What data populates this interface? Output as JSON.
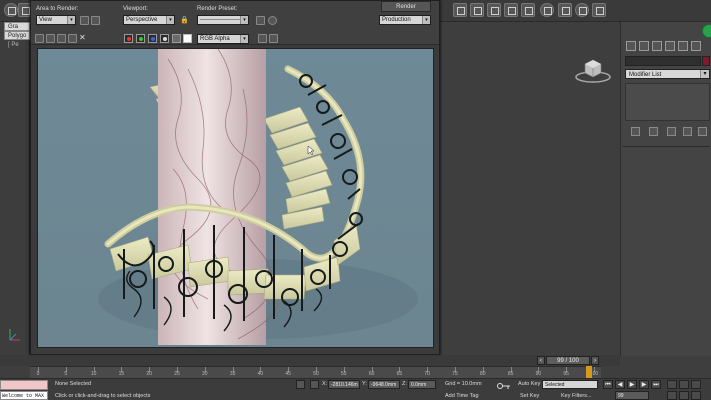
{
  "render_dialog": {
    "area_label": "Area to Render:",
    "area_value": "View",
    "viewport_label": "Viewport:",
    "viewport_value": "Perspective",
    "preset_label": "Render Preset:",
    "preset_value": "--------------------",
    "render_button": "Render",
    "production_value": "Production",
    "channel_value": "RGB Alpha"
  },
  "left_tabs": [
    "Gra",
    "Polygo"
  ],
  "viewport_label": "[ Pe",
  "command_panel": {
    "modifier_list": "Modifier List"
  },
  "timeline": {
    "frame": "99 / 100",
    "ticks": [
      "0",
      "5",
      "10",
      "15",
      "20",
      "25",
      "30",
      "35",
      "40",
      "45",
      "50",
      "55",
      "60",
      "65",
      "70",
      "75",
      "80",
      "85",
      "90",
      "95",
      "100"
    ]
  },
  "status_bar": {
    "selection": "None Selected",
    "prompt": "Click or click-and-drag to select objects",
    "x_label": "X:",
    "x_value": "-2810.146m",
    "y_label": "Y:",
    "y_value": "-9648.0mm",
    "z_label": "Z:",
    "z_value": "0.0mm",
    "grid": "Grid = 10.0mm",
    "add_time_tag": "Add Time Tag",
    "auto_key": "Auto Key",
    "selected": "Selected",
    "set_key": "Set Key",
    "key_filters": "Key Filters...",
    "frame_field": "99",
    "listener": "Welcome to MAX"
  },
  "colors": {
    "accent": "#d49a1c",
    "marble": "#d8c6c8",
    "background": "#6d8592"
  }
}
